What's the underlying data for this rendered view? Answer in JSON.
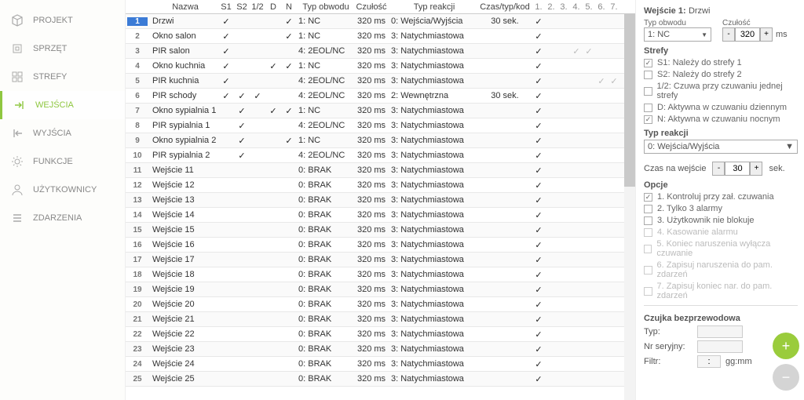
{
  "nav": {
    "items": [
      {
        "label": "PROJEKT",
        "icon": "cube"
      },
      {
        "label": "SPRZĘT",
        "icon": "chip"
      },
      {
        "label": "STREFY",
        "icon": "grid"
      },
      {
        "label": "WEJŚCIA",
        "icon": "in"
      },
      {
        "label": "WYJŚCIA",
        "icon": "out"
      },
      {
        "label": "FUNKCJE",
        "icon": "gear"
      },
      {
        "label": "UŻYTKOWNICY",
        "icon": "user"
      },
      {
        "label": "ZDARZENIA",
        "icon": "list"
      }
    ],
    "active": 3
  },
  "table": {
    "headers": [
      "",
      "Nazwa",
      "S1",
      "S2",
      "1/2",
      "D",
      "N",
      "Typ obwodu",
      "Czułość",
      "Typ reakcji",
      "Czas/typ/kod",
      "1.",
      "2.",
      "3.",
      "4.",
      "5.",
      "6.",
      "7."
    ],
    "rows": [
      {
        "n": 1,
        "name": "Drzwi",
        "s1": true,
        "s2": false,
        "h": false,
        "d": false,
        "n2": true,
        "typ": "1: NC",
        "cz": "320 ms",
        "react": "0: Wejścia/Wyjścia",
        "czas": "30 sek.",
        "m": [
          1,
          0,
          0,
          0,
          0,
          0,
          0
        ]
      },
      {
        "n": 2,
        "name": "Okno salon",
        "s1": true,
        "s2": false,
        "h": false,
        "d": false,
        "n2": true,
        "typ": "1: NC",
        "cz": "320 ms",
        "react": "3: Natychmiastowa",
        "czas": "",
        "m": [
          1,
          0,
          0,
          0,
          0,
          0,
          0
        ]
      },
      {
        "n": 3,
        "name": "PIR salon",
        "s1": true,
        "s2": false,
        "h": false,
        "d": false,
        "n2": false,
        "typ": "4: 2EOL/NC",
        "cz": "320 ms",
        "react": "3: Natychmiastowa",
        "czas": "",
        "m": [
          1,
          0,
          0,
          2,
          2,
          0,
          0
        ]
      },
      {
        "n": 4,
        "name": "Okno kuchnia",
        "s1": true,
        "s2": false,
        "h": false,
        "d": true,
        "n2": true,
        "typ": "1: NC",
        "cz": "320 ms",
        "react": "3: Natychmiastowa",
        "czas": "",
        "m": [
          1,
          0,
          0,
          0,
          0,
          0,
          0
        ]
      },
      {
        "n": 5,
        "name": "PIR kuchnia",
        "s1": true,
        "s2": false,
        "h": false,
        "d": false,
        "n2": false,
        "typ": "4: 2EOL/NC",
        "cz": "320 ms",
        "react": "3: Natychmiastowa",
        "czas": "",
        "m": [
          1,
          0,
          0,
          0,
          0,
          2,
          2
        ]
      },
      {
        "n": 6,
        "name": "PIR schody",
        "s1": true,
        "s2": true,
        "h": true,
        "d": false,
        "n2": false,
        "typ": "4: 2EOL/NC",
        "cz": "320 ms",
        "react": "2: Wewnętrzna",
        "czas": "30 sek.",
        "m": [
          1,
          0,
          0,
          0,
          0,
          0,
          0
        ]
      },
      {
        "n": 7,
        "name": "Okno sypialnia 1",
        "s1": false,
        "s2": true,
        "h": false,
        "d": true,
        "n2": true,
        "typ": "1: NC",
        "cz": "320 ms",
        "react": "3: Natychmiastowa",
        "czas": "",
        "m": [
          1,
          0,
          0,
          0,
          0,
          0,
          0
        ]
      },
      {
        "n": 8,
        "name": "PIR sypialnia 1",
        "s1": false,
        "s2": true,
        "h": false,
        "d": false,
        "n2": false,
        "typ": "4: 2EOL/NC",
        "cz": "320 ms",
        "react": "3: Natychmiastowa",
        "czas": "",
        "m": [
          1,
          0,
          0,
          0,
          0,
          0,
          0
        ]
      },
      {
        "n": 9,
        "name": "Okno sypialnia 2",
        "s1": false,
        "s2": true,
        "h": false,
        "d": false,
        "n2": true,
        "typ": "1: NC",
        "cz": "320 ms",
        "react": "3: Natychmiastowa",
        "czas": "",
        "m": [
          1,
          0,
          0,
          0,
          0,
          0,
          0
        ]
      },
      {
        "n": 10,
        "name": "PIR sypialnia 2",
        "s1": false,
        "s2": true,
        "h": false,
        "d": false,
        "n2": false,
        "typ": "4: 2EOL/NC",
        "cz": "320 ms",
        "react": "3: Natychmiastowa",
        "czas": "",
        "m": [
          1,
          0,
          0,
          0,
          0,
          0,
          0
        ]
      },
      {
        "n": 11,
        "name": "Wejście 11",
        "s1": false,
        "s2": false,
        "h": false,
        "d": false,
        "n2": false,
        "typ": "0: BRAK",
        "cz": "320 ms",
        "react": "3: Natychmiastowa",
        "czas": "",
        "m": [
          1,
          0,
          0,
          0,
          0,
          0,
          0
        ]
      },
      {
        "n": 12,
        "name": "Wejście 12",
        "s1": false,
        "s2": false,
        "h": false,
        "d": false,
        "n2": false,
        "typ": "0: BRAK",
        "cz": "320 ms",
        "react": "3: Natychmiastowa",
        "czas": "",
        "m": [
          1,
          0,
          0,
          0,
          0,
          0,
          0
        ]
      },
      {
        "n": 13,
        "name": "Wejście 13",
        "s1": false,
        "s2": false,
        "h": false,
        "d": false,
        "n2": false,
        "typ": "0: BRAK",
        "cz": "320 ms",
        "react": "3: Natychmiastowa",
        "czas": "",
        "m": [
          1,
          0,
          0,
          0,
          0,
          0,
          0
        ]
      },
      {
        "n": 14,
        "name": "Wejście 14",
        "s1": false,
        "s2": false,
        "h": false,
        "d": false,
        "n2": false,
        "typ": "0: BRAK",
        "cz": "320 ms",
        "react": "3: Natychmiastowa",
        "czas": "",
        "m": [
          1,
          0,
          0,
          0,
          0,
          0,
          0
        ]
      },
      {
        "n": 15,
        "name": "Wejście 15",
        "s1": false,
        "s2": false,
        "h": false,
        "d": false,
        "n2": false,
        "typ": "0: BRAK",
        "cz": "320 ms",
        "react": "3: Natychmiastowa",
        "czas": "",
        "m": [
          1,
          0,
          0,
          0,
          0,
          0,
          0
        ]
      },
      {
        "n": 16,
        "name": "Wejście 16",
        "s1": false,
        "s2": false,
        "h": false,
        "d": false,
        "n2": false,
        "typ": "0: BRAK",
        "cz": "320 ms",
        "react": "3: Natychmiastowa",
        "czas": "",
        "m": [
          1,
          0,
          0,
          0,
          0,
          0,
          0
        ]
      },
      {
        "n": 17,
        "name": "Wejście 17",
        "s1": false,
        "s2": false,
        "h": false,
        "d": false,
        "n2": false,
        "typ": "0: BRAK",
        "cz": "320 ms",
        "react": "3: Natychmiastowa",
        "czas": "",
        "m": [
          1,
          0,
          0,
          0,
          0,
          0,
          0
        ]
      },
      {
        "n": 18,
        "name": "Wejście 18",
        "s1": false,
        "s2": false,
        "h": false,
        "d": false,
        "n2": false,
        "typ": "0: BRAK",
        "cz": "320 ms",
        "react": "3: Natychmiastowa",
        "czas": "",
        "m": [
          1,
          0,
          0,
          0,
          0,
          0,
          0
        ]
      },
      {
        "n": 19,
        "name": "Wejście 19",
        "s1": false,
        "s2": false,
        "h": false,
        "d": false,
        "n2": false,
        "typ": "0: BRAK",
        "cz": "320 ms",
        "react": "3: Natychmiastowa",
        "czas": "",
        "m": [
          1,
          0,
          0,
          0,
          0,
          0,
          0
        ]
      },
      {
        "n": 20,
        "name": "Wejście 20",
        "s1": false,
        "s2": false,
        "h": false,
        "d": false,
        "n2": false,
        "typ": "0: BRAK",
        "cz": "320 ms",
        "react": "3: Natychmiastowa",
        "czas": "",
        "m": [
          1,
          0,
          0,
          0,
          0,
          0,
          0
        ]
      },
      {
        "n": 21,
        "name": "Wejście 21",
        "s1": false,
        "s2": false,
        "h": false,
        "d": false,
        "n2": false,
        "typ": "0: BRAK",
        "cz": "320 ms",
        "react": "3: Natychmiastowa",
        "czas": "",
        "m": [
          1,
          0,
          0,
          0,
          0,
          0,
          0
        ]
      },
      {
        "n": 22,
        "name": "Wejście 22",
        "s1": false,
        "s2": false,
        "h": false,
        "d": false,
        "n2": false,
        "typ": "0: BRAK",
        "cz": "320 ms",
        "react": "3: Natychmiastowa",
        "czas": "",
        "m": [
          1,
          0,
          0,
          0,
          0,
          0,
          0
        ]
      },
      {
        "n": 23,
        "name": "Wejście 23",
        "s1": false,
        "s2": false,
        "h": false,
        "d": false,
        "n2": false,
        "typ": "0: BRAK",
        "cz": "320 ms",
        "react": "3: Natychmiastowa",
        "czas": "",
        "m": [
          1,
          0,
          0,
          0,
          0,
          0,
          0
        ]
      },
      {
        "n": 24,
        "name": "Wejście 24",
        "s1": false,
        "s2": false,
        "h": false,
        "d": false,
        "n2": false,
        "typ": "0: BRAK",
        "cz": "320 ms",
        "react": "3: Natychmiastowa",
        "czas": "",
        "m": [
          1,
          0,
          0,
          0,
          0,
          0,
          0
        ]
      },
      {
        "n": 25,
        "name": "Wejście 25",
        "s1": false,
        "s2": false,
        "h": false,
        "d": false,
        "n2": false,
        "typ": "0: BRAK",
        "cz": "320 ms",
        "react": "3: Natychmiastowa",
        "czas": "",
        "m": [
          1,
          0,
          0,
          0,
          0,
          0,
          0
        ]
      }
    ],
    "selected": 1
  },
  "right": {
    "title_prefix": "Wejście 1:",
    "title_name": "Drzwi",
    "typ_obwodu_lbl": "Typ obwodu",
    "czulosc_lbl": "Czułość",
    "typ_obwodu": "1: NC",
    "czulosc_val": "320",
    "czulosc_unit": "ms",
    "strefy_title": "Strefy",
    "strefy": [
      {
        "c": true,
        "t": "S1: Należy do strefy 1"
      },
      {
        "c": false,
        "t": "S2: Należy do strefy 2"
      },
      {
        "c": false,
        "t": "1/2: Czuwa przy czuwaniu jednej strefy"
      },
      {
        "c": false,
        "t": "D: Aktywna w czuwaniu dziennym"
      },
      {
        "c": true,
        "t": "N: Aktywna w czuwaniu nocnym"
      }
    ],
    "typ_reakcji_title": "Typ reakcji",
    "typ_reakcji": "0: Wejścia/Wyjścia",
    "czas_lbl": "Czas na wejście",
    "czas_val": "30",
    "czas_unit": "sek.",
    "opcje_title": "Opcje",
    "opcje": [
      {
        "c": true,
        "t": "1. Kontroluj przy zał. czuwania",
        "d": false
      },
      {
        "c": false,
        "t": "2. Tylko 3 alarmy",
        "d": false
      },
      {
        "c": false,
        "t": "3. Użytkownik nie blokuje",
        "d": false
      },
      {
        "c": false,
        "t": "4. Kasowanie alarmu",
        "d": true
      },
      {
        "c": false,
        "t": "5. Koniec naruszenia wyłącza czuwanie",
        "d": true
      },
      {
        "c": false,
        "t": "6. Zapisuj naruszenia do pam. zdarzeń",
        "d": true
      },
      {
        "c": false,
        "t": "7. Zapisuj koniec nar. do pam. zdarzeń",
        "d": true
      }
    ],
    "czujka_title": "Czujka bezprzewodowa",
    "typ_lbl": "Typ:",
    "nr_lbl": "Nr seryjny:",
    "filtr_lbl": "Filtr:",
    "filtr_sep": ":",
    "filtr_unit": "gg:mm"
  }
}
